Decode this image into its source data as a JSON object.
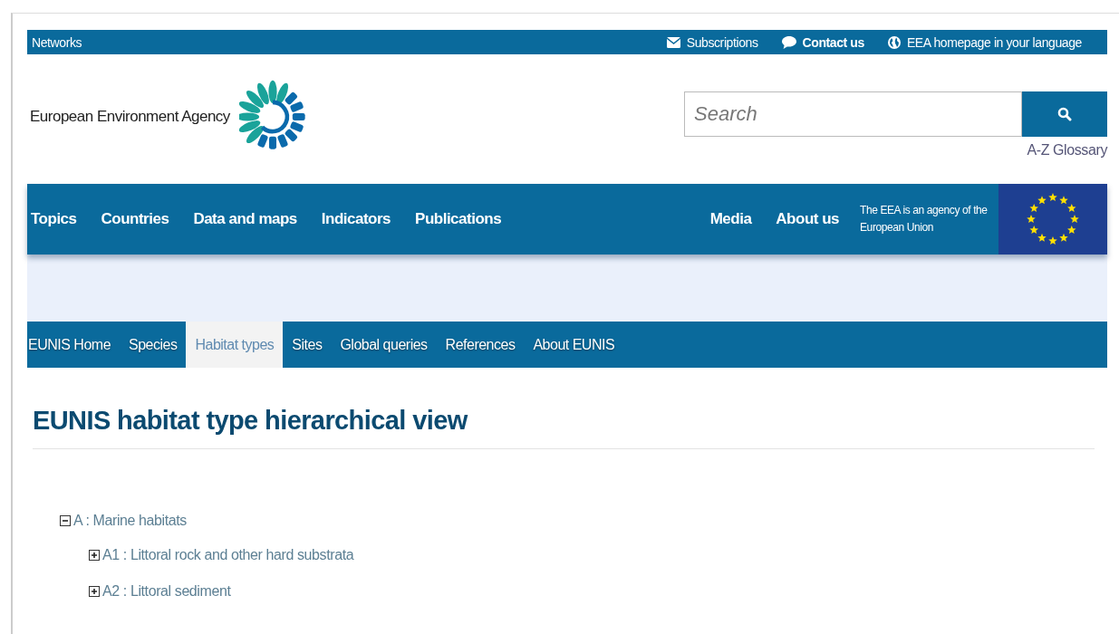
{
  "top_bar": {
    "left_link": "Networks",
    "links": [
      {
        "kind": "mail",
        "label": "Subscriptions",
        "bold": false
      },
      {
        "kind": "chat",
        "label": "Contact us",
        "bold": true
      },
      {
        "kind": "globe",
        "label": "EEA homepage in your language",
        "bold": false
      }
    ]
  },
  "header": {
    "logo_text": "European Environment Agency",
    "search": {
      "placeholder": "Search"
    },
    "glossary_link": "A-Z Glossary"
  },
  "main_nav": {
    "left": [
      "Topics",
      "Countries",
      "Data and maps",
      "Indicators",
      "Publications"
    ],
    "right": [
      "Media",
      "About us"
    ],
    "eu_note": "The EEA is an agency of the European Union"
  },
  "eunis_tabs": [
    {
      "label": "EUNIS Home",
      "selected": false
    },
    {
      "label": "Species",
      "selected": false
    },
    {
      "label": "Habitat types",
      "selected": true
    },
    {
      "label": "Sites",
      "selected": false
    },
    {
      "label": "Global queries",
      "selected": false
    },
    {
      "label": "References",
      "selected": false
    },
    {
      "label": "About EUNIS",
      "selected": false
    }
  ],
  "page_title": "EUNIS habitat type hierarchical view",
  "tree": [
    {
      "label": "A : Marine habitats",
      "expanded": true,
      "children": [
        {
          "label": "A1 : Littoral rock and other hard substrata",
          "expanded": false
        },
        {
          "label": "A2 : Littoral sediment",
          "expanded": false
        }
      ]
    }
  ]
}
